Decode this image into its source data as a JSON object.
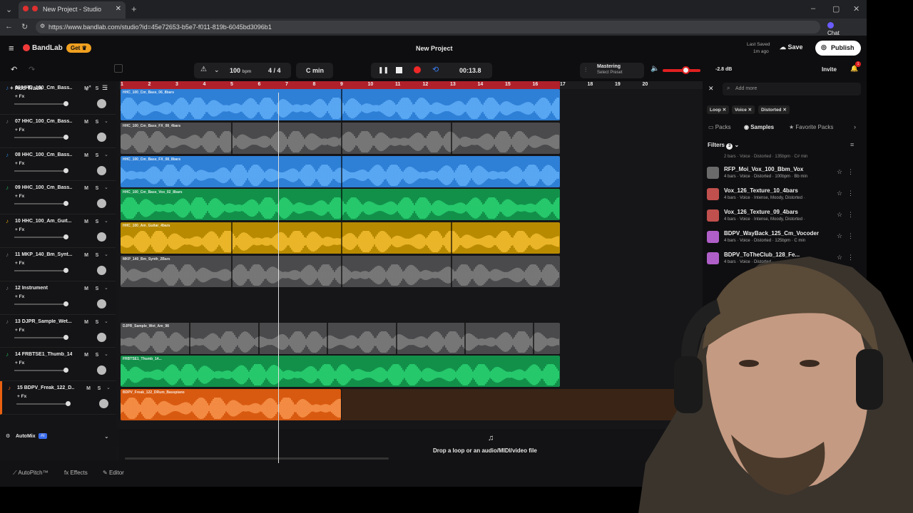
{
  "browser": {
    "tab_title": "New Project - Studio",
    "url": "https://www.bandlab.com/studio?id=45e72653-b5e7-f011-819b-6045bd3096b1",
    "chat_label": "Chat"
  },
  "header": {
    "logo": "BandLab",
    "get_label": "Get",
    "project_title": "New Project",
    "last_saved_label": "Last Saved",
    "last_saved_time": "1m ago",
    "save_label": "Save",
    "publish_label": "Publish"
  },
  "toolbar": {
    "bpm_value": "100",
    "bpm_unit": "bpm",
    "time_signature": "4 / 4",
    "key": "C min",
    "time": "00:13.8",
    "mastering_label": "Mastering",
    "mastering_preset": "Select Preset",
    "volume_db": "-2.8 dB",
    "volume_level": 0.6,
    "invite_label": "Invite",
    "notification_count": "1"
  },
  "tracks_header": {
    "add_track_label": "Add Track"
  },
  "tracks": [
    {
      "name": "06  HHC_100_Cm_Bass...",
      "fx": "+ Fx",
      "m": "M",
      "s": "S",
      "color": "#2e7fd6"
    },
    {
      "name": "07  HHC_100_Cm_Bass...",
      "fx": "+ Fx",
      "m": "M",
      "s": "S",
      "color": "#777"
    },
    {
      "name": "08  HHC_100_Cm_Bass...",
      "fx": "+ Fx",
      "m": "M",
      "s": "S",
      "color": "#2e7fd6"
    },
    {
      "name": "09  HHC_100_Cm_Bass...",
      "fx": "+ Fx",
      "m": "M",
      "s": "S",
      "color": "#1fb35a"
    },
    {
      "name": "10  HHC_100_Am_Guit...",
      "fx": "+ Fx",
      "m": "M",
      "s": "S",
      "color": "#e0a000"
    },
    {
      "name": "11  MKP_140_Bm_Synt...",
      "fx": "+ Fx",
      "m": "M",
      "s": "S",
      "color": "#777"
    },
    {
      "name": "12  Instrument",
      "fx": "+ Fx",
      "m": "M",
      "s": "S",
      "color": "#777"
    },
    {
      "name": "13  DJPR_Sample_Wet...",
      "fx": "+ Fx",
      "m": "M",
      "s": "S",
      "color": "#777"
    },
    {
      "name": "14  FRBTSE1_Thumb_14...",
      "fx": "+ Fx",
      "m": "M",
      "s": "S",
      "color": "#1fb35a"
    },
    {
      "name": "15  BDPV_Freak_122_D...",
      "fx": "+ Fx",
      "m": "M",
      "s": "S",
      "color": "#e86010"
    }
  ],
  "automix": {
    "label": "AutoMix",
    "badge": "AI"
  },
  "ruler": [
    "1",
    "2",
    "3",
    "4",
    "5",
    "6",
    "7",
    "8",
    "9",
    "10",
    "11",
    "12",
    "13",
    "14",
    "15",
    "16",
    "17",
    "18",
    "19",
    "20"
  ],
  "clips": [
    {
      "title": "HHC_100_Cm_Bass_06_8bars",
      "color": "#2e7fd6",
      "wave": "#6bb8ff"
    },
    {
      "title": "HHC_100_Cm_Bass_FX_08_4bars",
      "color": "#4a4a4c",
      "wave": "#8a8a8a"
    },
    {
      "title": "HHC_100_Cm_Bass_FX_08_8bars",
      "color": "#2e7fd6",
      "wave": "#6bb8ff"
    },
    {
      "title": "HHC_100_Cm_Bass_Vox_02_8bars",
      "color": "#12904a",
      "wave": "#2fe07a"
    },
    {
      "title": "HHC_100_Am_Guitar_4bars",
      "color": "#b88a00",
      "wave": "#ffc83a"
    },
    {
      "title": "MKP_140_Bm_Synth_2Bars",
      "color": "#4a4a4c",
      "wave": "#8a8a8a"
    },
    {
      "title": "",
      "color": "",
      "wave": ""
    },
    {
      "title": "DJPR_Sample_Wet_Am_98",
      "color": "#4a4a4c",
      "wave": "#8a8a8a"
    },
    {
      "title": "FRBTSE1_Thumb_14...",
      "color": "#12904a",
      "wave": "#2fe07a"
    },
    {
      "title": "BDPV_Freak_122_DRum_Basspiano",
      "color": "#d85a10",
      "wave": "#ffa05a"
    }
  ],
  "drop_zone": {
    "label": "Drop a loop or an audio/MIDI/video file"
  },
  "browser_panel": {
    "search_placeholder": "Add more",
    "chips": [
      "Loop",
      "Voice",
      "Distorted"
    ],
    "tabs": [
      "Packs",
      "Samples",
      "Favorite Packs"
    ],
    "filters_label": "Filters",
    "filters_count": "3",
    "top_partial": "2 bars · Voice · Distorted · 135bpm · C# min",
    "samples": [
      {
        "title": "RFP_Moi_Vox_100_Bbm_Vox",
        "meta": "4 bars · Voice · Distorted · 100bpm · Bb min",
        "color": "#6a6a6a"
      },
      {
        "title": "Vox_126_Texture_10_4bars",
        "meta": "4 bars · Voice · Intense, Moody, Distorted ·",
        "color": "#c0504d"
      },
      {
        "title": "Vox_126_Texture_09_4bars",
        "meta": "4 bars · Voice · Intense, Moody, Distorted ·",
        "color": "#c0504d"
      },
      {
        "title": "BDPV_WayBack_125_Cm_Vocoder",
        "meta": "4 bars · Voice · Distorted · 125bpm · C min",
        "color": "#b05fc8"
      },
      {
        "title": "BDPV_ToTheClub_128_Fe...",
        "meta": "4 bars · Voice · Distorted ·",
        "color": "#b05fc8"
      }
    ]
  },
  "bottom": {
    "autopitch_label": "AutoPitch™",
    "effects_label": "Effects",
    "editor_label": "Editor"
  }
}
